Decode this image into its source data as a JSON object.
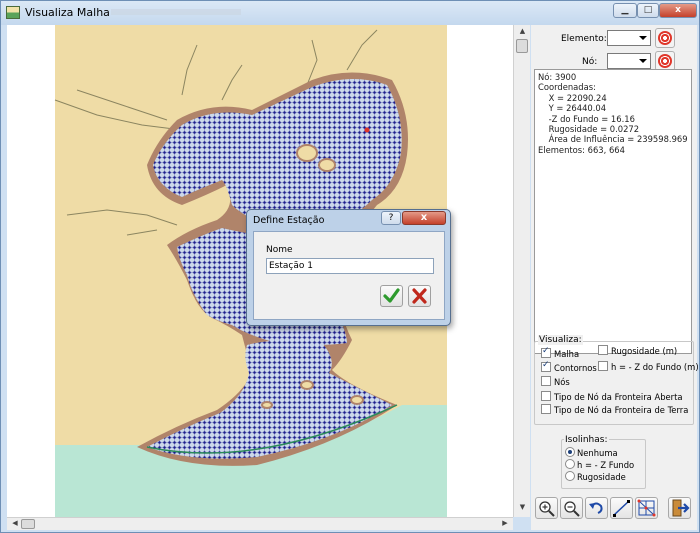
{
  "window": {
    "title": "Visualiza Malha",
    "minimize_label": "▁",
    "maximize_label": "□",
    "close_label": "x"
  },
  "panel": {
    "elemento_label": "Elemento:",
    "no_label": "Nó:",
    "info_lines": [
      "Nó: 3900",
      "",
      "Coordenadas:",
      "    X = 22090.24",
      "    Y = 26440.04",
      "    -Z do Fundo = 16.16",
      "    Rugosidade = 0.0272",
      "    Área de Influência = 239598.969",
      "Elementos: 663, 664"
    ],
    "visualiza": {
      "title": "Visualiza:",
      "malha": "Malha",
      "contornos": "Contornos",
      "nos": "Nós",
      "rugosidade": "Rugosidade (m)",
      "h_z_fundo": "h = - Z do Fundo (m)",
      "tipo_fronteira_aberta": "Tipo de Nó da Fronteira Aberta",
      "tipo_fronteira_terra": "Tipo de Nó da Fronteira de Terra"
    },
    "isolinhas": {
      "title": "Isolinhas:",
      "options": [
        "Nenhuma",
        "h = - Z Fundo",
        "Rugosidade"
      ]
    },
    "tools": [
      "zoom-in-icon",
      "zoom-out-icon",
      "undo-icon",
      "line-icon",
      "mesh-icon",
      "exit-icon"
    ]
  },
  "dialog": {
    "title": "Define Estação",
    "help_label": "?",
    "close_label": "x",
    "nome_label": "Nome",
    "nome_value": "Estação 1"
  },
  "colors": {
    "land": "#efdca6",
    "sea": "#b9e6d4",
    "mesh": "#1a1a8c",
    "coast": "#b0846a",
    "accent_red": "#e0362a"
  }
}
